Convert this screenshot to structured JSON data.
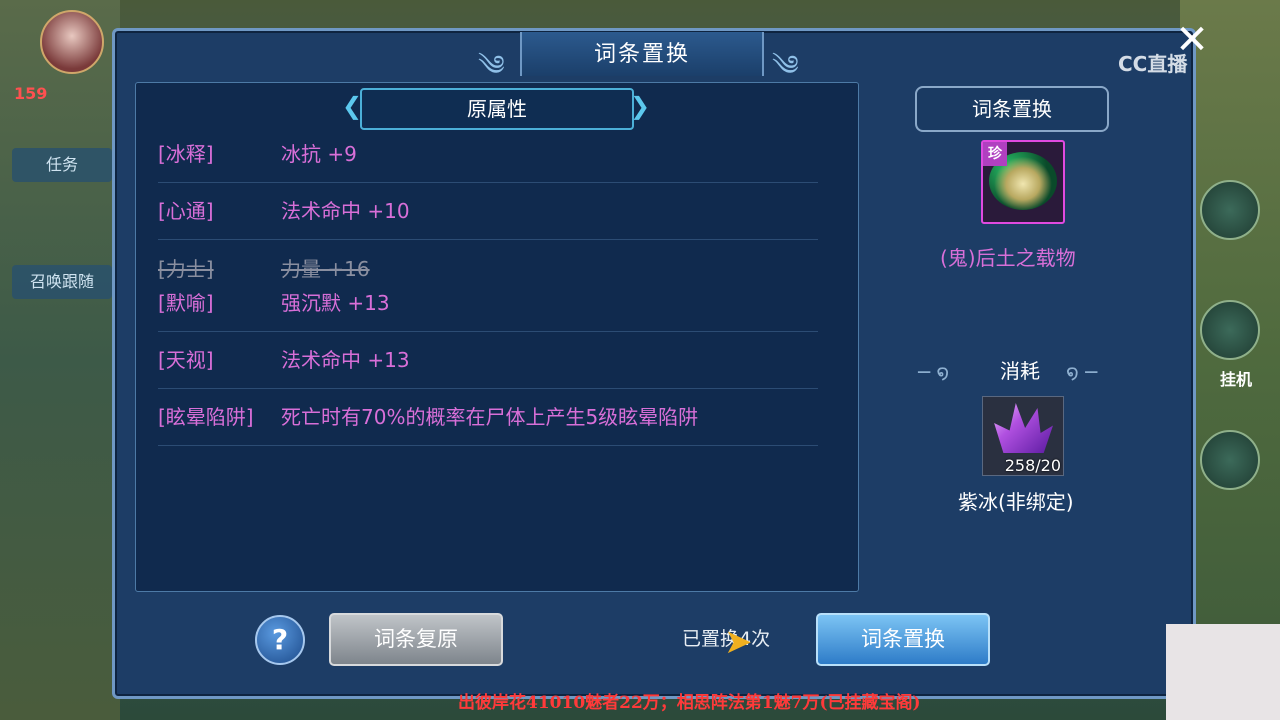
{
  "dialog": {
    "title": "词条置换",
    "close_icon": "close-icon"
  },
  "watermark": "CC直播",
  "hud": {
    "level": "159",
    "side_buttons": [
      "任务",
      "召唤跟随"
    ],
    "right_label": "挂机"
  },
  "original_attrs": {
    "header": "原属性",
    "rows": [
      {
        "key": "[冰释]",
        "value": "冰抗 +9",
        "struck": false
      },
      {
        "key": "[心通]",
        "value": "法术命中 +10",
        "struck": false
      },
      {
        "key": "[力士]",
        "value": "力量 +16",
        "struck": true
      },
      {
        "key": "[默喻]",
        "value": "强沉默 +13",
        "struck": false
      },
      {
        "key": "[天视]",
        "value": "法术命中 +13",
        "struck": false
      },
      {
        "key": "[眩晕陷阱]",
        "value": "死亡时有70%的概率在尸体上产生5级眩晕陷阱",
        "struck": false
      }
    ]
  },
  "replace_panel": {
    "header": "词条置换",
    "item_badge": "珍",
    "item_name": "(鬼)后土之载物",
    "consume_title": "消耗",
    "consume_count": "258/20",
    "consume_name": "紫冰(非绑定)"
  },
  "controls": {
    "help": "?",
    "restore_label": "词条复原",
    "replace_label": "词条置换",
    "replaced_text": "已置换4次"
  },
  "banner": "出彼岸花41010魅者22万；相思阵法第1魅7万(已挂藏宝阁)"
}
